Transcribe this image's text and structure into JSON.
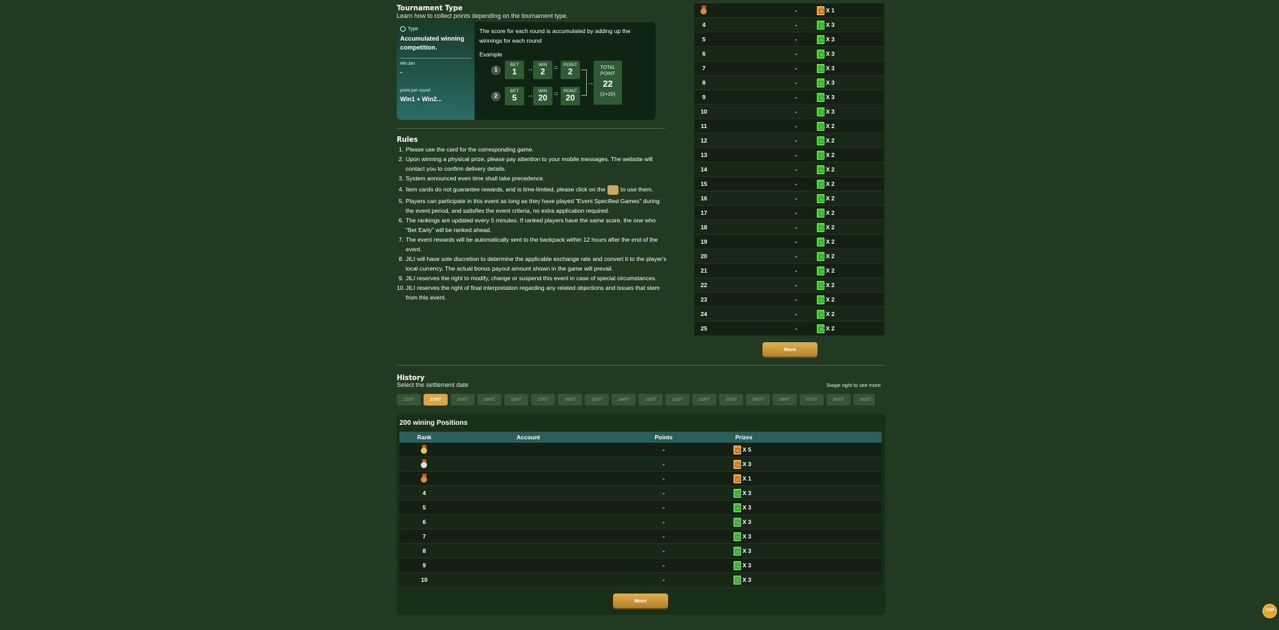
{
  "tournament": {
    "title": "Tournament Type",
    "subtitle": "Learn how to collect points depending on the tournament type.",
    "card": {
      "type_label": "Type",
      "type_name": "Accumulated winning competition.",
      "min_bet_label": "Min.bet",
      "min_bet_value": "-",
      "ppr_label": "point per round",
      "ppr_value": "Win1 + Win2...",
      "description": "The score for each round is accumulated by adding up the winnings for each round",
      "example_label": "Example",
      "rows": [
        {
          "num": "1",
          "bet_label": "BET",
          "bet": "1",
          "win_label": "WIN",
          "win": "2",
          "point_label": "POINT",
          "point": "2"
        },
        {
          "num": "2",
          "bet_label": "BET",
          "bet": "5",
          "win_label": "WIN",
          "win": "20",
          "point_label": "POINT",
          "point": "20"
        }
      ],
      "total_label": "TOTAL POINT",
      "total_value": "22",
      "total_sub": "(2+20)"
    }
  },
  "rules": {
    "title": "Rules",
    "items": [
      {
        "n": "1.",
        "text": "Please use the card for the corresponding game."
      },
      {
        "n": "2.",
        "text": "Upon winning a physical prize, please pay attention to your mobile messages. The website will contact you to confirm delivery details."
      },
      {
        "n": "3.",
        "text": "System announced even time shall take precedence."
      },
      {
        "n": "4.",
        "text_a": "Item cards do not guarantee rewards, and is time-limited, please click on the",
        "text_b": "to use them."
      },
      {
        "n": "5.",
        "text": "Players can participate in this event as long as they have played \"Event Specified Games\" during the event period, and satisfies the event criteria, no extra application required."
      },
      {
        "n": "6.",
        "text": "The rankings are updated every 5 minutes. If ranked players have the same score, the one who \"Bet Early\" will be ranked ahead."
      },
      {
        "n": "7.",
        "text": "The event rewards will be automatically sent to the backpack within 12 hours after the end of the event."
      },
      {
        "n": "8.",
        "text": "JILI will have sole discretion to determine the applicable exchange rate and convert it to the player's local currency. The actual bonus payout amount shown in the game will prevail."
      },
      {
        "n": "9.",
        "text": "JILI reserves the right to modify, change or suspend this event in case of special circumstances."
      },
      {
        "n": "10.",
        "text": "JILI reserves the right of final interpretation regarding any related objections and issues that stem from this event."
      }
    ]
  },
  "ranking": {
    "rows": [
      {
        "rank": "",
        "medal": "bronze",
        "points": "-",
        "chip": "gold",
        "mult": "X 1"
      },
      {
        "rank": "4",
        "points": "-",
        "chip": "green",
        "mult": "X 3"
      },
      {
        "rank": "5",
        "points": "-",
        "chip": "green",
        "mult": "X 3"
      },
      {
        "rank": "6",
        "points": "-",
        "chip": "green",
        "mult": "X 3"
      },
      {
        "rank": "7",
        "points": "-",
        "chip": "green",
        "mult": "X 3"
      },
      {
        "rank": "8",
        "points": "-",
        "chip": "green",
        "mult": "X 3"
      },
      {
        "rank": "9",
        "points": "-",
        "chip": "green",
        "mult": "X 3"
      },
      {
        "rank": "10",
        "points": "-",
        "chip": "green",
        "mult": "X 3"
      },
      {
        "rank": "11",
        "points": "-",
        "chip": "green",
        "mult": "X 2"
      },
      {
        "rank": "12",
        "points": "-",
        "chip": "green",
        "mult": "X 2"
      },
      {
        "rank": "13",
        "points": "-",
        "chip": "green",
        "mult": "X 2"
      },
      {
        "rank": "14",
        "points": "-",
        "chip": "green",
        "mult": "X 2"
      },
      {
        "rank": "15",
        "points": "-",
        "chip": "green",
        "mult": "X 2"
      },
      {
        "rank": "16",
        "points": "-",
        "chip": "green",
        "mult": "X 2"
      },
      {
        "rank": "17",
        "points": "-",
        "chip": "green",
        "mult": "X 2"
      },
      {
        "rank": "18",
        "points": "-",
        "chip": "green",
        "mult": "X 2"
      },
      {
        "rank": "19",
        "points": "-",
        "chip": "green",
        "mult": "X 2"
      },
      {
        "rank": "20",
        "points": "-",
        "chip": "green",
        "mult": "X 2"
      },
      {
        "rank": "21",
        "points": "-",
        "chip": "green",
        "mult": "X 2"
      },
      {
        "rank": "22",
        "points": "-",
        "chip": "green",
        "mult": "X 2"
      },
      {
        "rank": "23",
        "points": "-",
        "chip": "green",
        "mult": "X 2"
      },
      {
        "rank": "24",
        "points": "-",
        "chip": "green",
        "mult": "X 2"
      },
      {
        "rank": "25",
        "points": "-",
        "chip": "green",
        "mult": "X 2"
      }
    ],
    "more_label": "More"
  },
  "history": {
    "title": "History",
    "subtitle": "Select the settlement date",
    "swipe_hint": "Swipe right to see more",
    "dates": [
      "22/07",
      "21/07",
      "20/07",
      "19/07",
      "18/07",
      "17/07",
      "16/07",
      "15/07",
      "14/07",
      "13/07",
      "12/07",
      "11/07",
      "10/07",
      "09/07",
      "08/07",
      "07/07",
      "06/07",
      "05/07"
    ],
    "active_date": "21/07",
    "panel_title": "200 wining Positions",
    "columns": [
      "Rank",
      "Account",
      "Points",
      "Prizes"
    ],
    "rows": [
      {
        "rank": "",
        "medal": "gold",
        "points": "-",
        "chip": "gold",
        "mult": "X 5"
      },
      {
        "rank": "",
        "medal": "silver",
        "points": "-",
        "chip": "gold",
        "mult": "X 3"
      },
      {
        "rank": "",
        "medal": "bronze",
        "points": "-",
        "chip": "gold",
        "mult": "X 1"
      },
      {
        "rank": "4",
        "points": "-",
        "chip": "green",
        "mult": "X 3"
      },
      {
        "rank": "5",
        "points": "-",
        "chip": "green",
        "mult": "X 3"
      },
      {
        "rank": "6",
        "points": "-",
        "chip": "green",
        "mult": "X 3"
      },
      {
        "rank": "7",
        "points": "-",
        "chip": "green",
        "mult": "X 3"
      },
      {
        "rank": "8",
        "points": "-",
        "chip": "green",
        "mult": "X 3"
      },
      {
        "rank": "9",
        "points": "-",
        "chip": "green",
        "mult": "X 3"
      },
      {
        "rank": "10",
        "points": "-",
        "chip": "green",
        "mult": "X 3"
      }
    ],
    "more_label": "More"
  },
  "top_button": "TOP",
  "colors": {
    "background": "#213a21",
    "accent": "#d9a548",
    "table_head": "#2a5f5b",
    "chip_green": "#46c43a",
    "chip_gold": "#e9952b"
  }
}
